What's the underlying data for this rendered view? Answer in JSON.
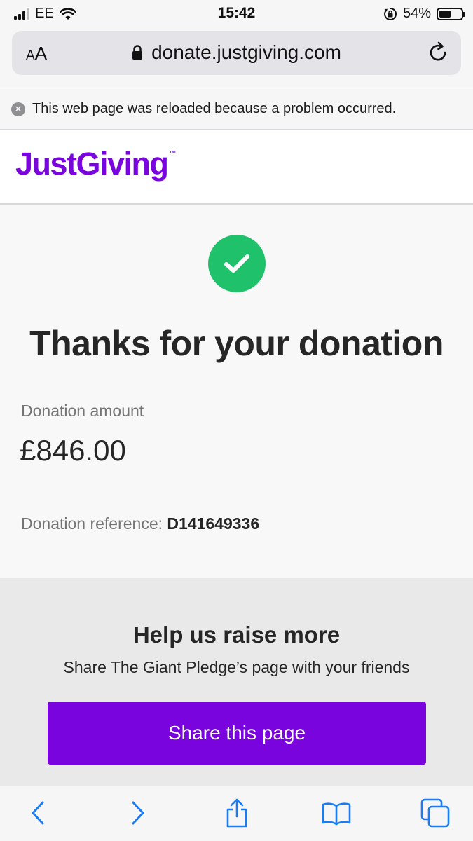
{
  "status_bar": {
    "carrier": "EE",
    "time": "15:42",
    "battery_percent": "54%",
    "battery_level": 0.54
  },
  "browser": {
    "aa_label_small": "A",
    "aa_label_big": "A",
    "url": "donate.justgiving.com"
  },
  "notice": {
    "text": "This web page was reloaded because a problem occurred."
  },
  "brand": {
    "logo_text": "JustGiving",
    "logo_tm": "™",
    "accent": "#7a04dd",
    "success": "#1fc16b"
  },
  "confirmation": {
    "title": "Thanks for your donation",
    "amount_label": "Donation amount",
    "amount_value": "£846.00",
    "reference_label": "Donation reference: ",
    "reference_value": "D141649336"
  },
  "share": {
    "title": "Help us raise more",
    "subtitle": "Share The Giant Pledge’s page with your friends",
    "button_label": "Share this page"
  },
  "toolbar": {
    "icons": [
      "chevron-left-icon",
      "chevron-right-icon",
      "share-icon",
      "bookmarks-icon",
      "tabs-icon"
    ]
  }
}
